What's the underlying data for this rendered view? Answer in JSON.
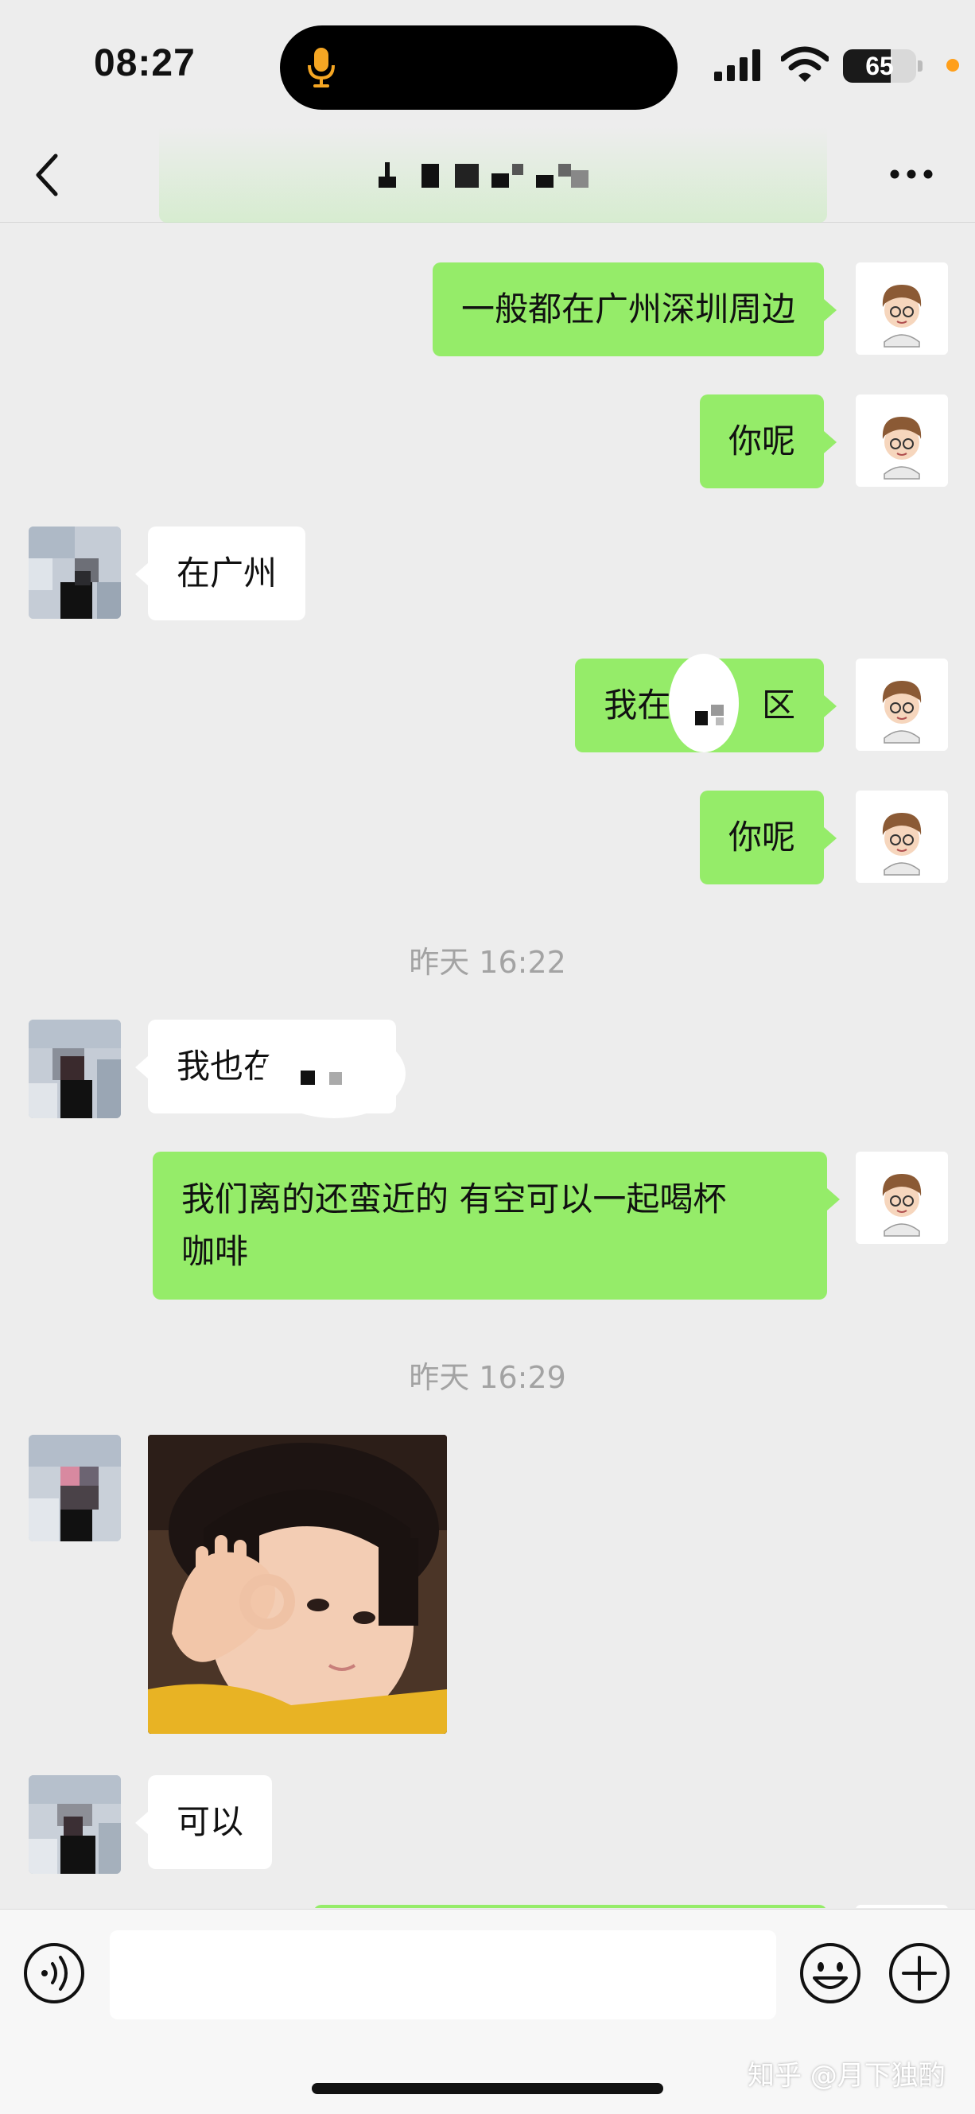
{
  "status_bar": {
    "time": "08:27",
    "battery_level": "65",
    "battery_fraction": 0.65,
    "icons": [
      "mic-icon",
      "signal-icon",
      "wifi-icon",
      "battery-icon"
    ]
  },
  "nav": {
    "back_icon": "chevron-left-icon",
    "title": "",
    "more_icon": "ellipsis-icon"
  },
  "messages": [
    {
      "from": "me",
      "text": "一般都在广州深圳周边"
    },
    {
      "from": "me",
      "text": "你呢"
    },
    {
      "from": "them",
      "text": "在广州"
    },
    {
      "from": "me",
      "text_before": "我在",
      "text_after": "区",
      "note": "partially obscured"
    },
    {
      "from": "me",
      "text": "你呢"
    },
    {
      "type": "timestamp",
      "text": "昨天 16:22"
    },
    {
      "from": "them",
      "text_before": "我也在"
    },
    {
      "from": "me",
      "line1": "我们离的还蛮近的 有空可以一起喝杯",
      "line2": "咖啡"
    },
    {
      "type": "timestamp",
      "text": "昨天 16:29"
    },
    {
      "from": "them",
      "type": "sticker",
      "sticker": "child-ok-gesture-sticker"
    },
    {
      "from": "them",
      "text": "可以"
    }
  ],
  "input_bar": {
    "voice_icon": "voice-icon",
    "emoji_icon": "emoji-icon",
    "plus_icon": "plus-icon",
    "input_value": ""
  },
  "watermark": "知乎 @月下独酌",
  "colors": {
    "background": "#ededed",
    "my_bubble": "#95ec69",
    "their_bubble": "#ffffff",
    "timestamp": "#a3a3a3",
    "battery_dot": "#ff9f1a"
  }
}
